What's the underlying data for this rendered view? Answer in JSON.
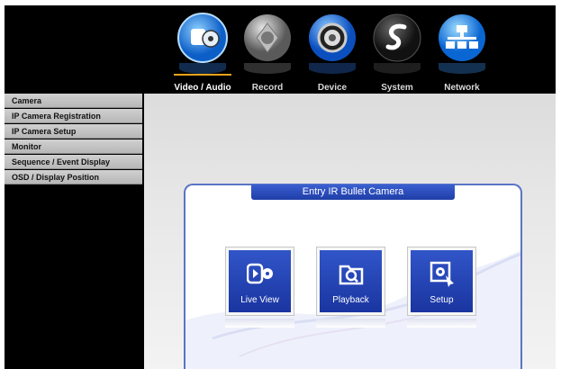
{
  "menu": [
    {
      "label": "Video / Audio",
      "icon": "video-audio-icon",
      "active": true
    },
    {
      "label": "Record",
      "icon": "record-icon",
      "active": false
    },
    {
      "label": "Device",
      "icon": "device-icon",
      "active": false
    },
    {
      "label": "System",
      "icon": "system-icon",
      "active": false
    },
    {
      "label": "Network",
      "icon": "network-icon",
      "active": false
    }
  ],
  "sidebar": [
    {
      "label": "Camera"
    },
    {
      "label": "IP Camera Registration"
    },
    {
      "label": "IP Camera Setup"
    },
    {
      "label": "Monitor"
    },
    {
      "label": "Sequence / Event Display"
    },
    {
      "label": "OSD / Display Position"
    }
  ],
  "panel": {
    "title": "Entry IR Bullet Camera"
  },
  "tiles": [
    {
      "label": "Live View",
      "icon": "live-view-icon"
    },
    {
      "label": "Playback",
      "icon": "playback-icon"
    },
    {
      "label": "Setup",
      "icon": "setup-icon"
    }
  ],
  "colors": {
    "accent": "#e8a21a",
    "tile_blue": "#2647b8",
    "panel_border": "#5b74c6"
  }
}
